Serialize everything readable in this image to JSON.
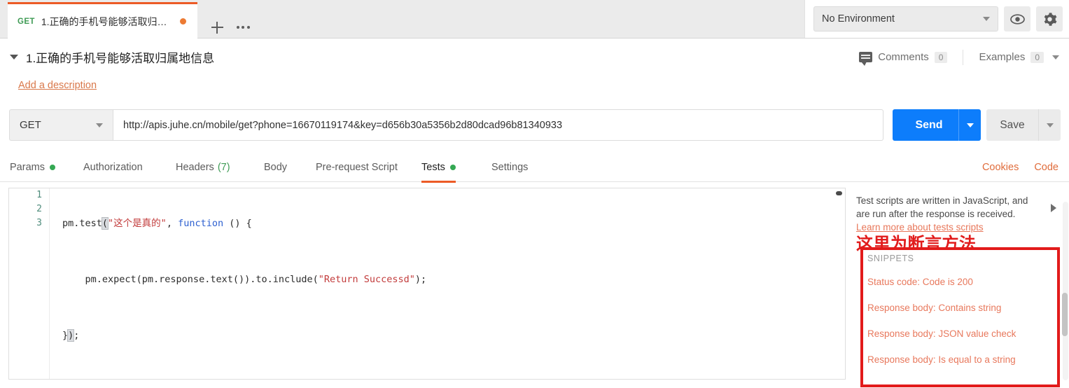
{
  "tabstrip": {
    "request_tab": {
      "method": "GET",
      "name": "1.正确的手机号能够活取归属地...",
      "unsaved_indicator": "dirty-dot"
    },
    "new_tab_icon": "plus-icon",
    "more_tabs_icon": "ellipsis-icon"
  },
  "environment": {
    "selected": "No Environment",
    "eye_icon": "eye-icon",
    "settings_icon": "gear-icon"
  },
  "request": {
    "title": "1.正确的手机号能够活取归属地信息",
    "description_link": "Add a description",
    "method": "GET",
    "url": "http://apis.juhe.cn/mobile/get?phone=16670119174&key=d656b30a5356b2d80dcad96b81340933",
    "send_label": "Send",
    "save_label": "Save"
  },
  "meta": {
    "comments_label": "Comments",
    "comments_count": "0",
    "examples_label": "Examples",
    "examples_count": "0"
  },
  "subtabs": [
    {
      "label": "Params",
      "dot": true,
      "count": "",
      "active": false
    },
    {
      "label": "Authorization",
      "dot": false,
      "count": "",
      "active": false
    },
    {
      "label": "Headers",
      "dot": false,
      "count": "(7)",
      "active": false
    },
    {
      "label": "Body",
      "dot": false,
      "count": "",
      "active": false
    },
    {
      "label": "Pre-request Script",
      "dot": false,
      "count": "",
      "active": false
    },
    {
      "label": "Tests",
      "dot": true,
      "count": "",
      "active": true
    },
    {
      "label": "Settings",
      "dot": false,
      "count": "",
      "active": false
    }
  ],
  "right_links": {
    "cookies": "Cookies",
    "code": "Code"
  },
  "editor": {
    "line_numbers": [
      "1",
      "2",
      "3"
    ],
    "line1": {
      "pre": "pm.test",
      "paren": "(",
      "str": "\"这个是真的\"",
      "mid": ", ",
      "kw": "function",
      "post": " () {"
    },
    "line2": {
      "pre": "    pm.expect(pm.response.text()).to.include(",
      "str": "\"Return Successd\"",
      "post": ");"
    },
    "line3": {
      "a": "}",
      "b": ")",
      "c": ";"
    }
  },
  "side_panel": {
    "help_text": "Test scripts are written in JavaScript, and are run after the response is received.",
    "learn_more": "Learn more about tests scripts",
    "annotation": "这里为断言方法",
    "snippets_header": "SNIPPETS",
    "snippets": [
      "Status code: Code is 200",
      "Response body: Contains string",
      "Response body: JSON value check",
      "Response body: Is equal to a string"
    ]
  },
  "colors": {
    "accent_orange": "#ec5b26",
    "send_blue": "#0d7dfb",
    "method_green": "#3f9b55",
    "annotation_red": "#e21b1b",
    "link_orange": "#e06c3b"
  }
}
